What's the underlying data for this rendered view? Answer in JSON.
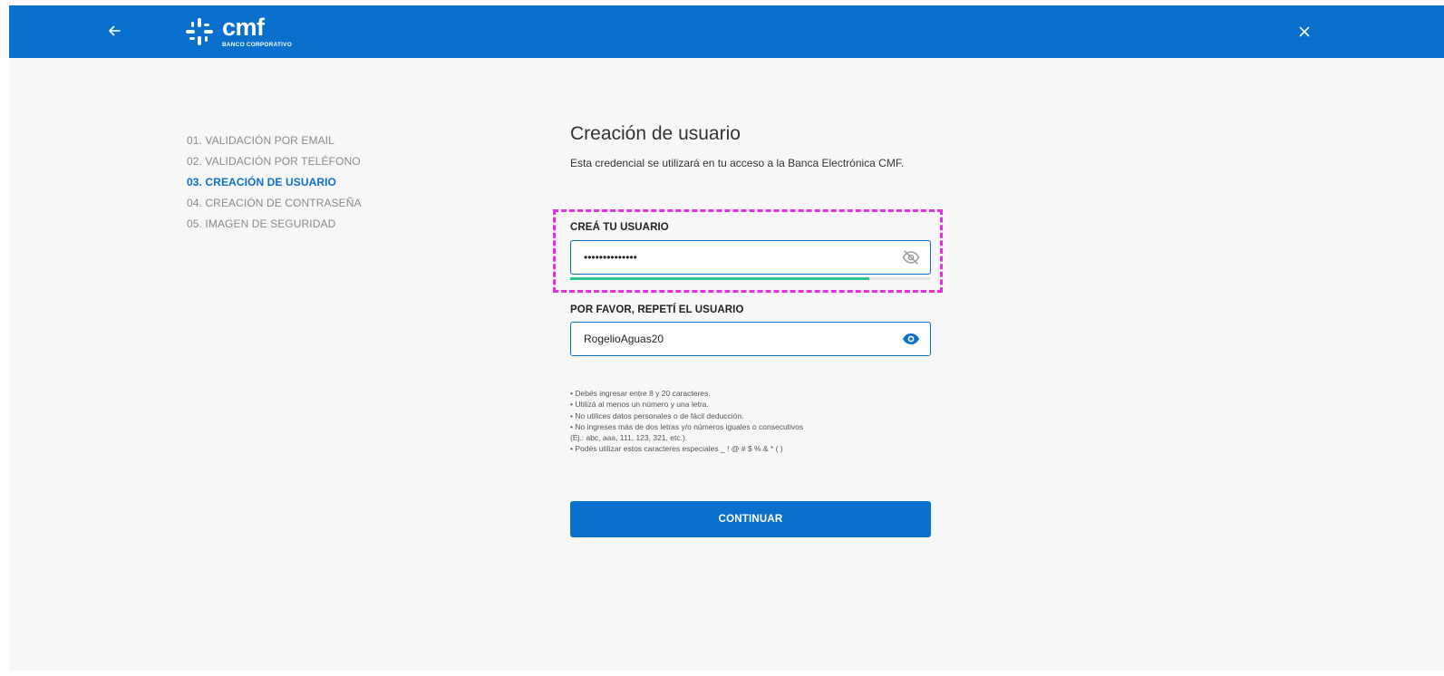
{
  "brand": {
    "name": "cmf",
    "subtitle": "BANCO CORPORATIVO",
    "header_color": "#0a70cd",
    "accent_color": "#0a70cd",
    "success_color": "#2ec38f"
  },
  "header": {
    "back_icon": "arrow-left-icon",
    "close_icon": "close-icon"
  },
  "steps": [
    {
      "label": "01. VALIDACIÓN POR EMAIL",
      "active": false
    },
    {
      "label": "02. VALIDACIÓN POR TELÉFONO",
      "active": false
    },
    {
      "label": "03. CREACIÓN DE USUARIO",
      "active": true
    },
    {
      "label": "04. CREACIÓN DE CONTRASEÑA",
      "active": false
    },
    {
      "label": "05. IMAGEN DE SEGURIDAD",
      "active": false
    }
  ],
  "form": {
    "title": "Creación de usuario",
    "subtitle": "Esta credencial se utilizará en tu acceso a la Banca Electrónica CMF.",
    "username": {
      "label": "CREÁ TU USUARIO",
      "value": "RogelioAguas20",
      "masked": true,
      "toggle_icon": "eye-off-icon",
      "strength": 0.83
    },
    "repeat_username": {
      "label": "POR FAVOR, REPETÍ EL USUARIO",
      "value": "RogelioAguas20",
      "masked": false,
      "toggle_icon": "eye-icon"
    },
    "rules": [
      "• Debés ingresar entre 8 y 20 caracteres.",
      "• Utilizá al menos un número y una letra.",
      "• No utilices datos personales o de fácil deducción.",
      "• No ingreses más de dos letras y/o números iguales o consecutivos",
      "(Ej.: abc, aaa, 111, 123, 321, etc.).",
      "• Podés utilizar estos caracteres especiales _ ! @ # $ % & * ( )"
    ],
    "continue_label": "CONTINUAR"
  }
}
